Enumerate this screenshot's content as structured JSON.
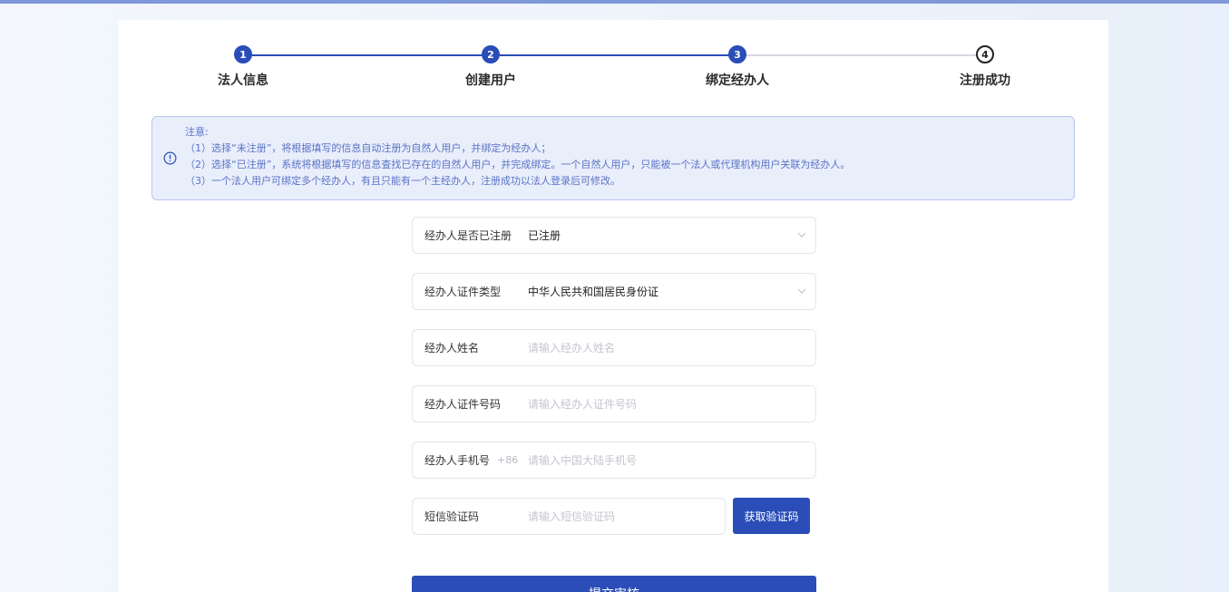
{
  "colors": {
    "primary": "#2a4db8",
    "notice_bg": "#e9eefb",
    "notice_border": "#b9c7f0",
    "notice_text": "#5a73c5",
    "top_bar": "#7f98d8"
  },
  "stepper": {
    "steps": [
      {
        "number": "1",
        "label": "法人信息",
        "status": "done"
      },
      {
        "number": "2",
        "label": "创建用户",
        "status": "done"
      },
      {
        "number": "3",
        "label": "绑定经办人",
        "status": "current"
      },
      {
        "number": "4",
        "label": "注册成功",
        "status": "pending"
      }
    ]
  },
  "notice": {
    "icon": "info-circle-icon",
    "title": "注意:",
    "lines": [
      "（1）选择“未注册”，将根据填写的信息自动注册为自然人用户，并绑定为经办人；",
      "（2）选择“已注册”，系统将根据填写的信息查找已存在的自然人用户，并完成绑定。一个自然人用户，只能被一个法人或代理机构用户关联为经办人。",
      "（3）一个法人用户可绑定多个经办人，有且只能有一个主经办人，注册成功以法人登录后可修改。"
    ]
  },
  "form": {
    "registered": {
      "label": "经办人是否已注册",
      "value": "已注册"
    },
    "id_type": {
      "label": "经办人证件类型",
      "value": "中华人民共和国居民身份证"
    },
    "name": {
      "label": "经办人姓名",
      "placeholder": "请输入经办人姓名",
      "value": ""
    },
    "id_number": {
      "label": "经办人证件号码",
      "placeholder": "请输入经办人证件号码",
      "value": ""
    },
    "phone": {
      "label": "经办人手机号",
      "prefix": "+86",
      "placeholder": "请输入中国大陆手机号",
      "value": ""
    },
    "sms_code": {
      "label": "短信验证码",
      "placeholder": "请输入短信验证码",
      "value": ""
    },
    "get_code_label": "获取验证码",
    "submit_label": "提交审核"
  }
}
